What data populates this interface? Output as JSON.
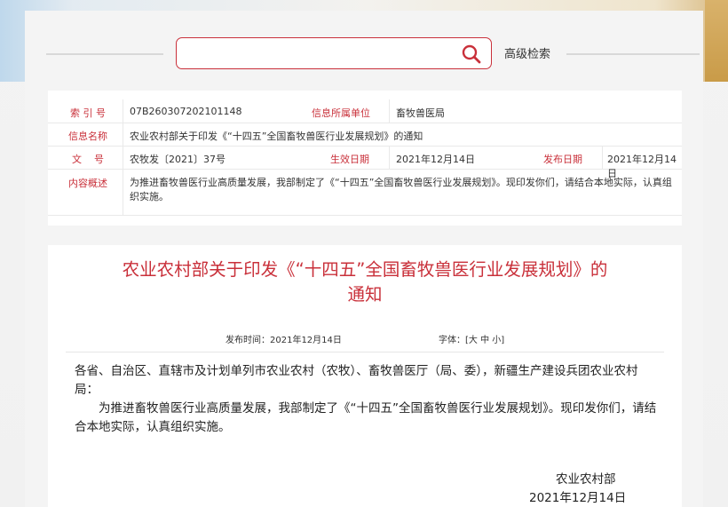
{
  "search": {
    "placeholder": "",
    "advanced_label": "高级检索"
  },
  "info": {
    "index_label": "索 引 号",
    "index_value": "07B260307202101148",
    "unit_label": "信息所属单位",
    "unit_value": "畜牧兽医局",
    "name_label": "信息名称",
    "name_value": "农业农村部关于印发《“十四五”全国畜牧兽医行业发展规划》的通知",
    "doc_label": "文    号",
    "doc_value": "农牧发〔2021〕37号",
    "effective_label": "生效日期",
    "effective_value": "2021年12月14日",
    "publish_label": "发布日期",
    "publish_value": "2021年12月14日",
    "summary_label": "内容概述",
    "summary_value": "为推进畜牧兽医行业高质量发展，我部制定了《“十四五”全国畜牧兽医行业发展规划》。现印发你们，请结合本地实际，认真组织实施。"
  },
  "article": {
    "title_line1": "农业农村部关于印发《“十四五”全国畜牧兽医行业发展规划》的",
    "title_line2": "通知",
    "published_label": "发布时间：",
    "published_value": "2021年12月14日",
    "font_label": "字体：",
    "font_open": "[",
    "font_large": "大",
    "font_medium": "中",
    "font_small": "小",
    "font_close": "]",
    "para1": "各省、自治区、直辖市及计划单列市农业农村（农牧）、畜牧兽医厅（局、委），新疆生产建设兵团农业农村局：",
    "para2": "为推进畜牧兽医行业高质量发展，我部制定了《“十四五”全国畜牧兽医行业发展规划》。现印发你们，请结合本地实际，认真组织实施。",
    "signature_org": "农业农村部",
    "signature_date": "2021年12月14日"
  },
  "colors": {
    "accent": "#c9303a"
  }
}
